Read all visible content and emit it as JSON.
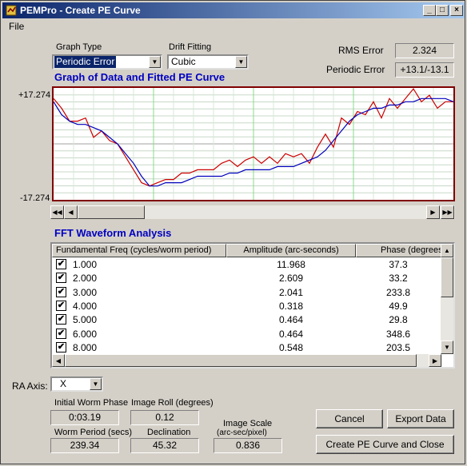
{
  "window": {
    "title": "PEMPro - Create PE Curve"
  },
  "menu": {
    "file": "File"
  },
  "controls": {
    "graph_type_label": "Graph Type",
    "graph_type_value": "Periodic Error",
    "drift_fitting_label": "Drift Fitting",
    "drift_fitting_value": "Cubic",
    "rms_error_label": "RMS Error",
    "rms_error_value": "2.324",
    "periodic_error_label": "Periodic Error",
    "periodic_error_value": "+13.1/-13.1"
  },
  "chart_heading": "Graph of Data and Fitted PE Curve",
  "chart_data": {
    "type": "line",
    "ylim": [
      -17.274,
      17.274
    ],
    "y_tick_labels": [
      "+17.274",
      "-17.274"
    ],
    "grid": true,
    "series": [
      {
        "color": "#cc0000",
        "x": [
          0,
          2,
          4,
          6,
          8,
          10,
          12,
          14,
          16,
          18,
          20,
          22,
          24,
          26,
          28,
          30,
          32,
          34,
          36,
          38,
          40,
          42,
          44,
          46,
          48,
          50,
          52,
          54,
          56,
          58,
          60,
          62,
          64,
          66,
          68,
          70,
          72,
          74,
          76,
          78,
          80,
          82,
          84,
          86,
          88,
          90,
          92,
          94,
          96,
          98,
          100
        ],
        "values": [
          14,
          11,
          7,
          7,
          8,
          2,
          4,
          1,
          0,
          -4,
          -8,
          -12,
          -13,
          -12,
          -11,
          -11,
          -9,
          -9,
          -8,
          -8,
          -8,
          -6,
          -5,
          -7,
          -5,
          -4,
          -6,
          -4,
          -6,
          -3,
          -4,
          -3,
          -6,
          -1,
          3,
          -1,
          8,
          6,
          10,
          9,
          13,
          8,
          14,
          11,
          14,
          17,
          13,
          15,
          11,
          13,
          13
        ]
      },
      {
        "color": "#0000bb",
        "x": [
          0,
          2,
          4,
          6,
          8,
          10,
          12,
          14,
          16,
          18,
          20,
          22,
          24,
          26,
          28,
          30,
          32,
          34,
          36,
          38,
          40,
          42,
          44,
          46,
          48,
          50,
          52,
          54,
          56,
          58,
          60,
          62,
          64,
          66,
          68,
          70,
          72,
          74,
          76,
          78,
          80,
          82,
          84,
          86,
          88,
          90,
          92,
          94,
          96,
          98,
          100
        ],
        "values": [
          13,
          9,
          7,
          6,
          6,
          5,
          4,
          2,
          0,
          -3,
          -6,
          -10,
          -13,
          -13,
          -12,
          -12,
          -12,
          -11,
          -10,
          -10,
          -10,
          -10,
          -9,
          -9,
          -8,
          -8,
          -8,
          -8,
          -7,
          -7,
          -7,
          -6,
          -5,
          -4,
          -2,
          1,
          4,
          7,
          9,
          10,
          11,
          11,
          12,
          12,
          13,
          13,
          14,
          14,
          14,
          14,
          13
        ]
      }
    ]
  },
  "fft": {
    "heading": "FFT Waveform Analysis",
    "columns": [
      "Fundamental Freq (cycles/worm period)",
      "Amplitude (arc-seconds)",
      "Phase (degrees)"
    ],
    "rows": [
      {
        "checked": "✔",
        "freq": "1.000",
        "amp": "11.968",
        "phase": "37.3"
      },
      {
        "checked": "✔",
        "freq": "2.000",
        "amp": "2.609",
        "phase": "33.2"
      },
      {
        "checked": "✔",
        "freq": "3.000",
        "amp": "2.041",
        "phase": "233.8"
      },
      {
        "checked": "✔",
        "freq": "4.000",
        "amp": "0.318",
        "phase": "49.9"
      },
      {
        "checked": "✔",
        "freq": "5.000",
        "amp": "0.464",
        "phase": "29.8"
      },
      {
        "checked": "✔",
        "freq": "6.000",
        "amp": "0.464",
        "phase": "348.6"
      },
      {
        "checked": "✔",
        "freq": "8.000",
        "amp": "0.548",
        "phase": "203.5"
      }
    ]
  },
  "bottom": {
    "ra_axis_label": "RA Axis:",
    "ra_axis_value": "X",
    "initial_worm_phase_label": "Initial Worm Phase",
    "initial_worm_phase_value": "0:03.19",
    "image_roll_label": "Image Roll (degrees)",
    "image_roll_value": "0.12",
    "worm_period_label": "Worm Period (secs)",
    "worm_period_value": "239.34",
    "declination_label": "Declination",
    "declination_value": "45.32",
    "image_scale_label": "Image Scale",
    "image_scale_sub": "(arc-sec/pixel)",
    "image_scale_value": "0.836",
    "cancel": "Cancel",
    "export": "Export Data",
    "create": "Create PE Curve and Close"
  }
}
